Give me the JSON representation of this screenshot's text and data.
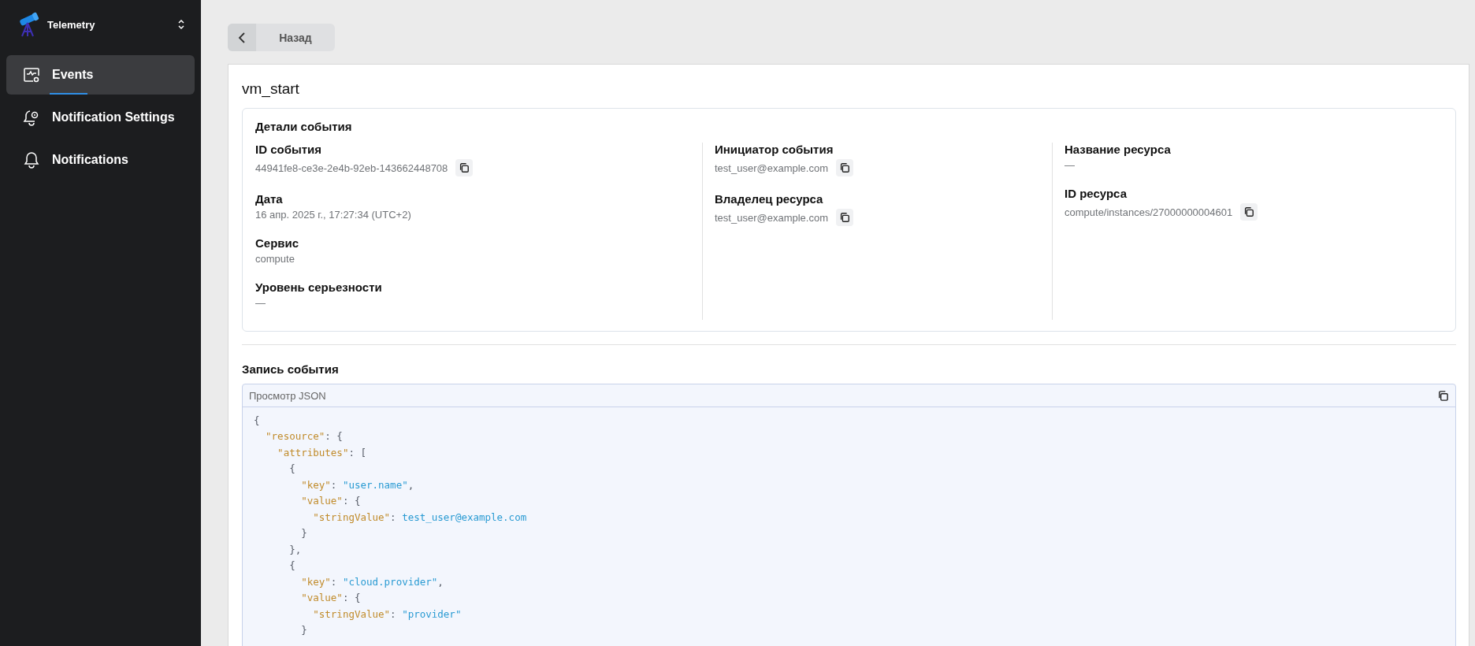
{
  "sidebar": {
    "app_name": "Telemetry",
    "items": [
      {
        "label": "Events",
        "kind": "activity",
        "selected": true
      },
      {
        "label": "Notification Settings",
        "kind": "bell-gear",
        "selected": false
      },
      {
        "label": "Notifications",
        "kind": "bell",
        "selected": false
      }
    ]
  },
  "back_button": {
    "label": "Назад"
  },
  "event_title": "vm_start",
  "details": {
    "title": "Детали события",
    "columns": [
      [
        {
          "label": "ID события",
          "value": "44941fe8-ce3e-2e4b-92eb-143662448708",
          "copyable": true
        },
        {
          "label": "Дата",
          "value": "16 апр. 2025 г., 17:27:34 (UTC+2)",
          "copyable": false
        },
        {
          "label": "Сервис",
          "value": "compute",
          "copyable": false
        },
        {
          "label": "Уровень серьезности",
          "value": "—",
          "copyable": false
        }
      ],
      [
        {
          "label": "Инициатор события",
          "value": "test_user@example.com",
          "copyable": true
        },
        {
          "label": "Владелец ресурса",
          "value": "test_user@example.com",
          "copyable": true
        }
      ],
      [
        {
          "label": "Название ресурса",
          "value": "—",
          "copyable": false
        },
        {
          "label": "ID ресурса",
          "value": "compute/instances/27000000004601",
          "copyable": true
        }
      ]
    ]
  },
  "record": {
    "title": "Запись события",
    "viewer_title": "Просмотр JSON",
    "code_lines": [
      [
        {
          "kind": "punct",
          "text": "{"
        }
      ],
      [
        {
          "kind": "key",
          "text": "  \"resource\""
        },
        {
          "kind": "punct",
          "text": ": {"
        }
      ],
      [
        {
          "kind": "key",
          "text": "    \"attributes\""
        },
        {
          "kind": "punct",
          "text": ": ["
        }
      ],
      [
        {
          "kind": "punct",
          "text": "      {"
        }
      ],
      [
        {
          "kind": "key",
          "text": "        \"key\""
        },
        {
          "kind": "punct",
          "text": ": "
        },
        {
          "kind": "string",
          "text": "\"user.name\""
        },
        {
          "kind": "punct",
          "text": ","
        }
      ],
      [
        {
          "kind": "key",
          "text": "        \"value\""
        },
        {
          "kind": "punct",
          "text": ": {"
        }
      ],
      [
        {
          "kind": "key",
          "text": "          \"stringValue\""
        },
        {
          "kind": "punct",
          "text": ": "
        },
        {
          "kind": "string",
          "text": "test_user@example.com"
        }
      ],
      [
        {
          "kind": "punct",
          "text": "        }"
        }
      ],
      [
        {
          "kind": "punct",
          "text": "      },"
        }
      ],
      [
        {
          "kind": "punct",
          "text": "      {"
        }
      ],
      [
        {
          "kind": "key",
          "text": "        \"key\""
        },
        {
          "kind": "punct",
          "text": ": "
        },
        {
          "kind": "string",
          "text": "\"cloud.provider\""
        },
        {
          "kind": "punct",
          "text": ","
        }
      ],
      [
        {
          "kind": "key",
          "text": "        \"value\""
        },
        {
          "kind": "punct",
          "text": ": {"
        }
      ],
      [
        {
          "kind": "key",
          "text": "          \"stringValue\""
        },
        {
          "kind": "punct",
          "text": ": "
        },
        {
          "kind": "string",
          "text": "\"provider\""
        }
      ],
      [
        {
          "kind": "punct",
          "text": "        }"
        }
      ]
    ]
  }
}
